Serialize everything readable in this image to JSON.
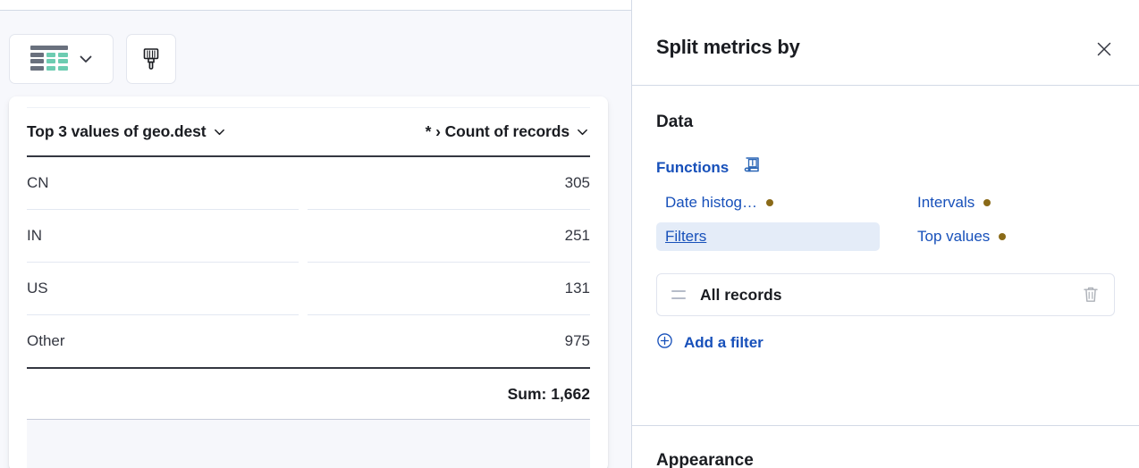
{
  "toolbar": {
    "visualization_button": {
      "icon": "table-grid-icon",
      "chevron": "chevron-down-icon"
    },
    "style_button": {
      "icon": "paintbrush-icon"
    }
  },
  "table": {
    "columns": [
      {
        "label": "Top 3 values of geo.dest",
        "chevron": "chevron-down-icon"
      },
      {
        "label": "* › Count of records",
        "chevron": "chevron-down-icon"
      }
    ],
    "rows": [
      {
        "bucket": "CN",
        "count": "305"
      },
      {
        "bucket": "IN",
        "count": "251"
      },
      {
        "bucket": "US",
        "count": "131"
      },
      {
        "bucket": "Other",
        "count": "975"
      }
    ],
    "summary": "Sum: 1,662"
  },
  "flyout": {
    "title": "Split metrics by",
    "close_icon": "close-icon",
    "section_data": "Data",
    "functions": {
      "label": "Functions",
      "doc_icon": "book-info-icon",
      "items": [
        {
          "label": "Date histog…",
          "has_dot": true,
          "selected": false
        },
        {
          "label": "Intervals",
          "has_dot": true,
          "selected": false
        },
        {
          "label": "Filters",
          "has_dot": false,
          "selected": true
        },
        {
          "label": "Top values",
          "has_dot": true,
          "selected": false
        }
      ]
    },
    "filters": {
      "rows": [
        {
          "handle_icon": "drag-handle-icon",
          "label": "All records",
          "delete_icon": "trash-icon"
        }
      ],
      "add_label": "Add a filter",
      "add_icon": "plus-circle-icon"
    },
    "section_appearance": "Appearance"
  },
  "colors": {
    "link": "#1750ba",
    "dot": "#8a6a18",
    "selected_bg": "#e4ecf8",
    "rule": "#343741",
    "accent_green": "#6dccb1",
    "accent_gray": "#69707d"
  }
}
